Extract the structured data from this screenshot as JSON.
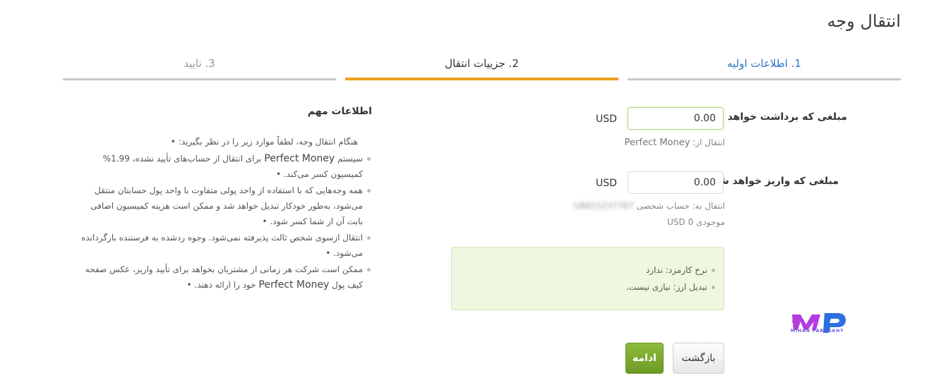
{
  "page": {
    "title": "انتقال وجه"
  },
  "steps": [
    {
      "label": "1. اطلاعات اولیه"
    },
    {
      "label": "2. جزییات انتقال"
    },
    {
      "label": "3. تایید"
    }
  ],
  "form": {
    "withdraw": {
      "label": "مبلغی که برداشت خواهد شد",
      "value": "0.00",
      "currency": "USD",
      "from_label": "انتقال از:",
      "from_value": "Perfect Money"
    },
    "deposit": {
      "label": "مبلغی که واریز خواهد شد",
      "value": "0.00",
      "currency": "USD",
      "to_label": "انتقال به:",
      "to_value": "حساب شخصی",
      "to_account": "U8815237767",
      "balance": "موجودی 0 USD"
    }
  },
  "fees": {
    "items": [
      "نرخ کارمزد: ندارد",
      "تبدیل ارز: نیازی نیست."
    ]
  },
  "info": {
    "title": "اطلاعات مهم",
    "intro": "هنگام انتقال وجه، لطفاً موارد زیر را در نظر بگیرید: •",
    "items": [
      {
        "before": "سیستم ",
        "brand": "Perfect Money",
        "after": " برای انتقال از حساب‌های تأیید نشده، 1.99% کمیسیون کسر می‌کند. •"
      },
      {
        "before": "همه وجه‌هایی که با استفاده از واحد پولی متفاوت با واحد پول حسابتان منتقل می‌شود، به‌طور خودکار تبدیل خواهد شد و ممکن است هزینه کمیسیون اضافی بابت آن از شما کسر شود. •",
        "brand": "",
        "after": ""
      },
      {
        "before": "انتقال ازسوی شخص ثالث پذیرفته نمی‌شود. وجوه ردشده به فرستنده بازگردانده می‌شود. •",
        "brand": "",
        "after": ""
      },
      {
        "before": "ممکن است شرکت هر زمانی از مشتریان بخواهد برای تأیید واریز، عکس صفحه کیف پول ",
        "brand": "Perfect Money",
        "after": " خود را ارائه دهند. •"
      }
    ]
  },
  "buttons": {
    "continue": "ادامه",
    "back": "بازگشت"
  },
  "logo": {
    "text": "MIHAN PARDAKHT",
    "colors": [
      "#2d6fe0",
      "#b43be0"
    ]
  }
}
